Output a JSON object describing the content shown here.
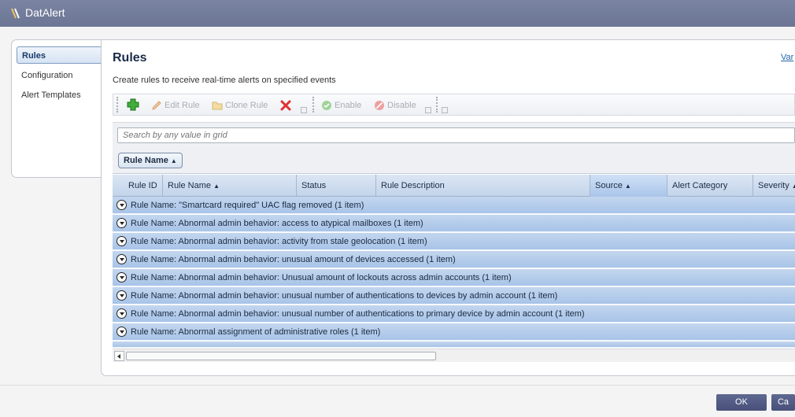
{
  "window": {
    "title": "DatAlert"
  },
  "nav": {
    "items": [
      {
        "label": "Rules"
      },
      {
        "label": "Configuration"
      },
      {
        "label": "Alert Templates"
      }
    ]
  },
  "page": {
    "title": "Rules",
    "subtitle": "Create rules to receive real-time alerts on specified events",
    "help_link": "Var"
  },
  "toolbar": {
    "add_icon": "green-plus-icon",
    "edit_label": "Edit Rule",
    "clone_label": "Clone Rule",
    "delete_icon": "red-x-icon",
    "enable_label": "Enable",
    "disable_label": "Disable"
  },
  "search": {
    "placeholder": "Search by any value in grid"
  },
  "grouping": {
    "chip_label": "Rule Name"
  },
  "columns": [
    "Rule ID",
    "Rule Name",
    "Status",
    "Rule Description",
    "Source",
    "Alert Category",
    "Severity"
  ],
  "groups": [
    "Rule Name: \"Smartcard required\" UAC flag removed (1 item)",
    "Rule Name: Abnormal admin behavior: access to atypical mailboxes (1 item)",
    "Rule Name: Abnormal admin behavior: activity from stale geolocation (1 item)",
    "Rule Name: Abnormal admin behavior: unusual amount of devices accessed (1 item)",
    "Rule Name: Abnormal admin behavior: Unusual amount of lockouts across admin accounts (1 item)",
    "Rule Name: Abnormal admin behavior: unusual number of authentications to devices by admin account (1 item)",
    "Rule Name: Abnormal admin behavior: unusual number of authentications to primary device by admin account (1 item)",
    "Rule Name: Abnormal assignment of administrative roles (1 item)"
  ],
  "footer": {
    "ok_label": "OK",
    "cancel_label": "Ca"
  },
  "colors": {
    "titlebar": "#6b7594",
    "group_row": "#b3cbeb",
    "header": "#c9d9ee",
    "accent_button": "#525a85"
  }
}
